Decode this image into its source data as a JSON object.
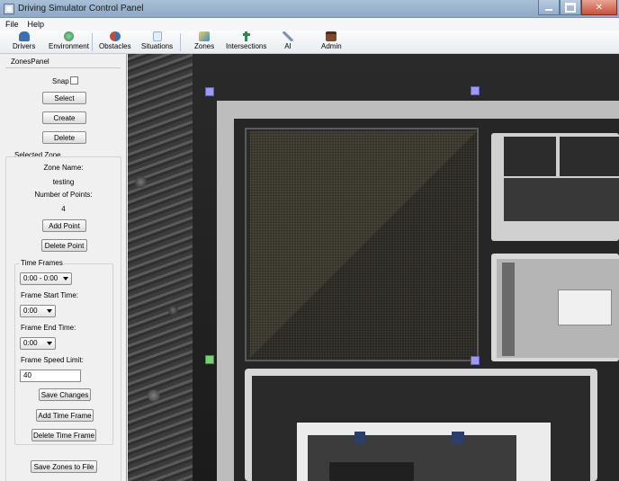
{
  "window": {
    "title": "Driving Simulator Control Panel"
  },
  "menu": [
    {
      "label": "File"
    },
    {
      "label": "Help"
    }
  ],
  "toolbar": [
    {
      "label": "Drivers",
      "icon": "car-icon",
      "color": "#3a6fb0"
    },
    {
      "label": "Environment",
      "icon": "globe-icon",
      "color": "#3aa864"
    },
    {
      "label": "Obstacles",
      "icon": "obstacles-icon",
      "color": "#c74a3c"
    },
    {
      "label": "Situations",
      "icon": "document-icon",
      "color": "#8fb2d8"
    },
    {
      "label": "Zones",
      "icon": "zones-icon",
      "color": "#d9a12f"
    },
    {
      "label": "Intersections",
      "icon": "intersection-icon",
      "color": "#2e8b4a"
    },
    {
      "label": "AI",
      "icon": "ai-icon",
      "color": "#7c93b3"
    },
    {
      "label": "Admin",
      "icon": "briefcase-icon",
      "color": "#7a4a2a"
    }
  ],
  "panel": {
    "title": "ZonesPanel",
    "snap_label": "Snap",
    "snap_checked": false,
    "select_label": "Select",
    "create_label": "Create",
    "delete_label": "Delete",
    "selected_zone_title": "Selected Zone",
    "zone_name_label": "Zone Name:",
    "zone_name_value": "testing",
    "num_points_label": "Number of Points:",
    "num_points_value": "4",
    "add_point_label": "Add Point",
    "delete_point_label": "Delete Point",
    "time_frames_title": "Time Frames",
    "time_frame_selected": "0:00 - 0:00",
    "frame_start_label": "Frame Start Time:",
    "frame_start_value": "0:00",
    "frame_end_label": "Frame End Time:",
    "frame_end_value": "0:00",
    "speed_limit_label": "Frame Speed Limit:",
    "speed_limit_value": "40",
    "save_changes_label": "Save Changes",
    "add_time_frame_label": "Add Time Frame",
    "delete_time_frame_label": "Delete Time Frame",
    "save_zones_label": "Save Zones to File"
  },
  "colors": {
    "zone_marker": "#9b9bef",
    "zone_marker_selected": "#7ad07a"
  }
}
